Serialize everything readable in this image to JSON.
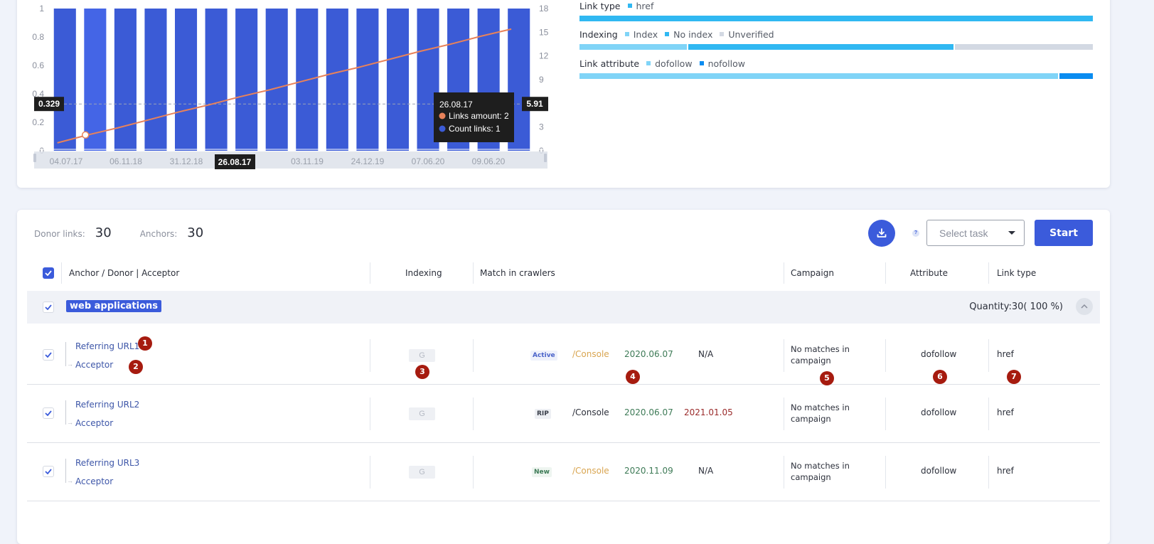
{
  "chart_data": {
    "type": "bar",
    "title": "",
    "xlabel": "",
    "ylabel": "",
    "categories": [
      "04.07.17",
      "26.08.17",
      "",
      "06.11.18",
      "",
      "31.12.18",
      "",
      "…9",
      "",
      "03.11.19",
      "",
      "24.12.19",
      "",
      "07.06.20",
      "",
      "09.06.20"
    ],
    "x_tick_labels": [
      "04.07.17",
      "06.11.18",
      "31.12.18",
      "9",
      "03.11.19",
      "24.12.19",
      "07.06.20",
      "09.06.20"
    ],
    "y_left": {
      "ticks": [
        "0",
        "0.2",
        "0.4",
        "0.6",
        "0.8",
        "1"
      ],
      "range": [
        0,
        1
      ]
    },
    "y_right": {
      "ticks": [
        "0",
        "3",
        "6",
        "9",
        "12",
        "15",
        "18"
      ],
      "range": [
        0,
        18
      ]
    },
    "series": [
      {
        "name": "Count links",
        "type": "bar",
        "axis": "left",
        "color": "#3b5bd6",
        "values": [
          1,
          1,
          1,
          1,
          1,
          1,
          1,
          1,
          1,
          1,
          1,
          1,
          1,
          1,
          1,
          1
        ]
      },
      {
        "name": "Links amount",
        "type": "line",
        "axis": "right",
        "color": "#e8825a",
        "values": [
          1.0,
          2.0,
          2.9,
          3.9,
          4.9,
          5.8,
          6.8,
          7.7,
          8.7,
          9.7,
          10.6,
          11.6,
          12.6,
          13.5,
          14.5,
          15.4
        ]
      }
    ],
    "highlight_index": 1,
    "crosshair": {
      "left_value": "0.329",
      "right_value": "5.91",
      "x_label": "26.08.17"
    },
    "tooltip": {
      "date": "26.08.17",
      "items": [
        {
          "label": "Links amount: 2",
          "color": "#e8825a"
        },
        {
          "label": "Count links: 1",
          "color": "#3b5bd6"
        }
      ]
    },
    "grid": false,
    "legend": "none"
  },
  "stats": [
    {
      "title": "Link type",
      "segments": [
        {
          "label": "href",
          "color": "#30b8f2",
          "fraction": 1.0
        }
      ]
    },
    {
      "title": "Indexing",
      "segments": [
        {
          "label": "Index",
          "color": "#80d4f7",
          "fraction": 0.21
        },
        {
          "label": "No index",
          "color": "#30b8f2",
          "fraction": 0.52
        },
        {
          "label": "Unverified",
          "color": "#d3d9e3",
          "fraction": 0.27
        }
      ]
    },
    {
      "title": "Link attribute",
      "segments": [
        {
          "label": "dofollow",
          "color": "#80d4f7",
          "fraction": 0.935
        },
        {
          "label": "nofollow",
          "color": "#0a8cf0",
          "fraction": 0.065
        }
      ]
    }
  ],
  "summary": {
    "donor_links_label": "Donor links:",
    "donor_links_value": "30",
    "anchors_label": "Anchors:",
    "anchors_value": "30"
  },
  "toolbar": {
    "help": "?",
    "select_placeholder": "Select task",
    "start_label": "Start"
  },
  "table": {
    "headers": {
      "anchor": "Anchor / Donor | Acceptor",
      "indexing": "Indexing",
      "match": "Match in crawlers",
      "campaign": "Campaign",
      "attribute": "Attribute",
      "link_type": "Link type"
    },
    "group": {
      "name": "web applications",
      "quantity": "Quantity:30( 100 %)"
    },
    "rows": [
      {
        "referring": "Referring URL1",
        "acceptor": "Acceptor",
        "indexing": "G",
        "status": "Active",
        "status_color": "#4a63c9",
        "status_bg": "#eef1fb",
        "console": "/Console",
        "console_color": "#d9a550",
        "date_first": "2020.06.07",
        "date_last": "N/A",
        "date_last_color": "#2b2f3a",
        "campaign": "No matches in campaign",
        "attribute": "dofollow",
        "link_type": "href"
      },
      {
        "referring": "Referring URL2",
        "acceptor": "Acceptor",
        "indexing": "G",
        "status": "RIP",
        "status_color": "#3a3f4a",
        "status_bg": "#eef0f4",
        "console": "/Console",
        "console_color": "#2b2f3a",
        "date_first": "2020.06.07",
        "date_last": "2021.01.05",
        "date_last_color": "#9a2a2a",
        "campaign": "No matches in campaign",
        "attribute": "dofollow",
        "link_type": "href"
      },
      {
        "referring": "Referring URL3",
        "acceptor": "Acceptor",
        "indexing": "G",
        "status": "New",
        "status_color": "#3d7a56",
        "status_bg": "#eef5f0",
        "console": "/Console",
        "console_color": "#d9a550",
        "date_first": "2020.11.09",
        "date_last": "N/A",
        "date_last_color": "#2b2f3a",
        "campaign": "No matches in campaign",
        "attribute": "dofollow",
        "link_type": "href"
      }
    ]
  },
  "markers": [
    "1",
    "2",
    "3",
    "4",
    "5",
    "6",
    "7"
  ]
}
